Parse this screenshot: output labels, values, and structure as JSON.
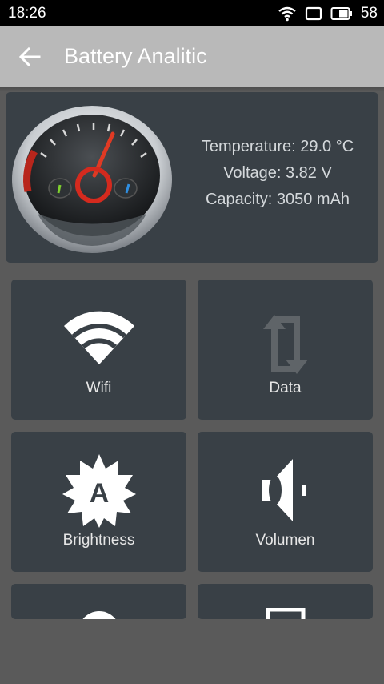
{
  "status_bar": {
    "time": "18:26",
    "battery_level": "58",
    "icons": [
      "wifi-icon",
      "screen-icon",
      "battery-icon"
    ]
  },
  "app_bar": {
    "title": "Battery Analitic",
    "back_icon": "arrow-left-icon"
  },
  "battery_info": {
    "gauge_icon": "speedometer-icon",
    "temperature": "Temperature: 29.0 °C",
    "voltage": "Voltage: 3.82 V",
    "capacity": "Capacity: 3050 mAh"
  },
  "tiles": [
    {
      "label": "Wifi",
      "icon": "wifi-icon"
    },
    {
      "label": "Data",
      "icon": "data-sync-icon"
    },
    {
      "label": "Brightness",
      "icon": "brightness-auto-icon"
    },
    {
      "label": "Volumen",
      "icon": "speaker-icon"
    },
    {
      "label": "",
      "icon": "circle-icon"
    },
    {
      "label": "",
      "icon": "square-icon"
    }
  ],
  "colors": {
    "background": "#5a5a5a",
    "app_bar": "#b9b9b9",
    "card": "#394046",
    "accent_red": "#d42a1e"
  }
}
